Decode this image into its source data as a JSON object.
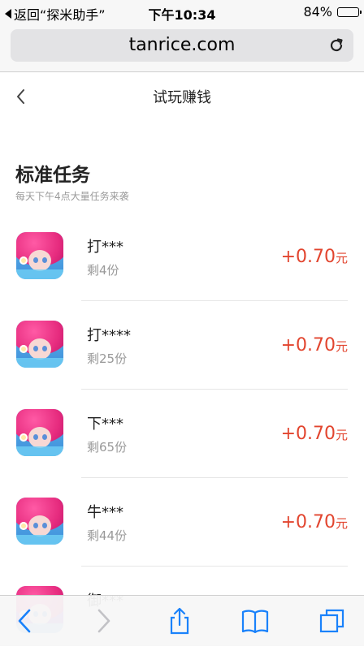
{
  "status_bar": {
    "back_label": "返回“探米助手”",
    "time": "下午10:34",
    "battery_text": "84%",
    "battery_level": 0.84
  },
  "browser": {
    "url": "tanrice.com"
  },
  "header": {
    "title": "试玩赚钱"
  },
  "section": {
    "title": "标准任务",
    "subtitle": "每天下午4点大量任务来袭"
  },
  "tasks": [
    {
      "name": "打***",
      "remaining": "剩4份",
      "reward": "+0.70",
      "unit": "元"
    },
    {
      "name": "打****",
      "remaining": "剩25份",
      "reward": "+0.70",
      "unit": "元"
    },
    {
      "name": "下***",
      "remaining": "剩65份",
      "reward": "+0.70",
      "unit": "元"
    },
    {
      "name": "牛***",
      "remaining": "剩44份",
      "reward": "+0.70",
      "unit": "元"
    },
    {
      "name": "御***",
      "remaining": "",
      "reward": "",
      "unit": ""
    }
  ],
  "colors": {
    "accent_reward": "#e2452f",
    "ios_blue": "#1a82fb"
  },
  "icons": {
    "back": "chevron-left-icon",
    "reload": "reload-icon",
    "toolbar": [
      "back-icon",
      "forward-icon",
      "share-icon",
      "bookmarks-icon",
      "tabs-icon"
    ]
  }
}
